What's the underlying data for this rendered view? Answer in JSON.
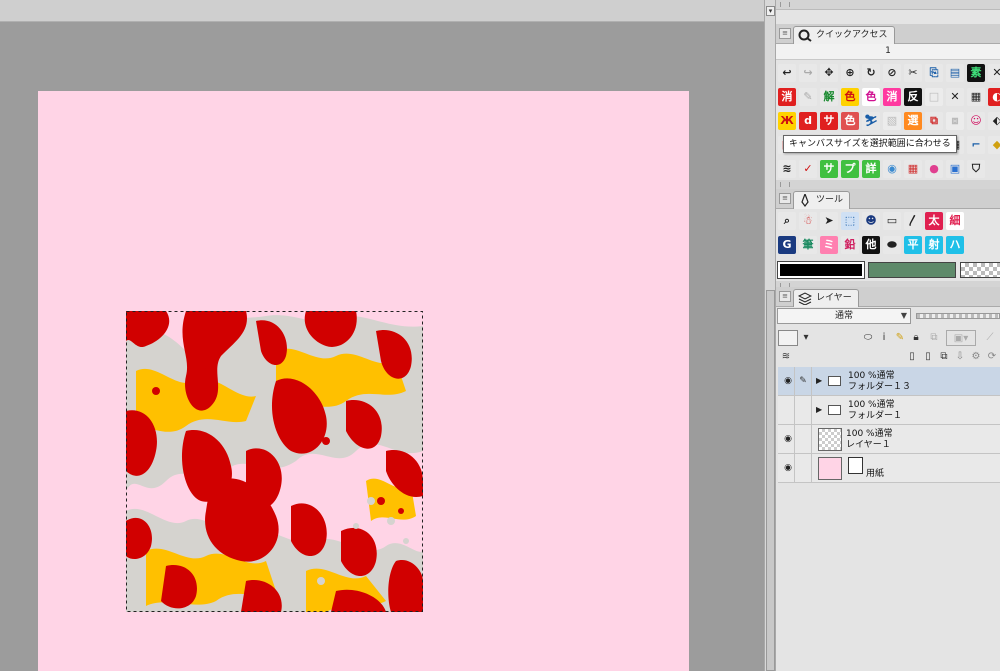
{
  "quick_access": {
    "tab_label": "クイックアクセス",
    "page_number": "1",
    "tooltip": "キャンバスサイズを選択範囲に合わせる",
    "icon_rows": [
      [
        {
          "glyph": "↩",
          "bg": "#e8e8e8",
          "fg": "#222",
          "name": "undo-icon"
        },
        {
          "glyph": "↪",
          "bg": "#e8e8e8",
          "fg": "#aaa",
          "name": "redo-icon"
        },
        {
          "glyph": "✥",
          "bg": "#e8e8e8",
          "fg": "#222",
          "name": "transform-icon"
        },
        {
          "glyph": "⊕",
          "bg": "#e8e8e8",
          "fg": "#222",
          "name": "crosshair-icon"
        },
        {
          "glyph": "↻",
          "bg": "#e8e8e8",
          "fg": "#222",
          "name": "rotate-icon"
        },
        {
          "glyph": "⊘",
          "bg": "#e8e8e8",
          "fg": "#222",
          "name": "clear-icon"
        },
        {
          "glyph": "✂",
          "bg": "#e8e8e8",
          "fg": "#222",
          "name": "cut-icon"
        },
        {
          "glyph": "⎘",
          "bg": "#e8e8e8",
          "fg": "#1a5ea8",
          "name": "copy-icon"
        },
        {
          "glyph": "▤",
          "bg": "#e8e8e8",
          "fg": "#1a5ea8",
          "name": "paste-icon"
        },
        {
          "glyph": "素",
          "bg": "#111111",
          "fg": "#3fe07a",
          "name": "material-icon"
        },
        {
          "glyph": "✕",
          "bg": "#e8e8e8",
          "fg": "#222",
          "name": "close-small-icon"
        }
      ],
      [
        {
          "glyph": "消",
          "bg": "#e02020",
          "fg": "#ffffff",
          "name": "erase-icon"
        },
        {
          "glyph": "✎",
          "bg": "#e8e8e8",
          "fg": "#aaa",
          "name": "pen-off-icon"
        },
        {
          "glyph": "解",
          "bg": "#e8e8e8",
          "fg": "#1a8a30",
          "name": "deselect-icon"
        },
        {
          "glyph": "色",
          "bg": "#ffd200",
          "fg": "#d01010",
          "name": "color-select-icon"
        },
        {
          "glyph": "色",
          "bg": "#ffffff",
          "fg": "#d01090",
          "name": "color-select-2-icon"
        },
        {
          "glyph": "消",
          "bg": "#ff3aa0",
          "fg": "#ffffff",
          "name": "erase-2-icon"
        },
        {
          "glyph": "反",
          "bg": "#111111",
          "fg": "#ffffff",
          "name": "invert-icon"
        },
        {
          "glyph": "□",
          "bg": "#ececec",
          "fg": "#bbb",
          "name": "dim-icon"
        },
        {
          "glyph": "✕",
          "bg": "#e8e8e8",
          "fg": "#222",
          "name": "cross-icon"
        },
        {
          "glyph": "▦",
          "bg": "#e8e8e8",
          "fg": "#222",
          "name": "grid-select-icon"
        },
        {
          "glyph": "◐",
          "bg": "#e02020",
          "fg": "#fff",
          "name": "red-mask-icon"
        }
      ],
      [
        {
          "glyph": "Ж",
          "bg": "#ffd200",
          "fg": "#d01010",
          "name": "scissors-select-icon"
        },
        {
          "glyph": "d",
          "bg": "#e02020",
          "fg": "#ffffff",
          "name": "brush-d-icon"
        },
        {
          "glyph": "サ",
          "bg": "#e02020",
          "fg": "#ffffff",
          "name": "sa-icon"
        },
        {
          "glyph": "色",
          "bg": "#e05050",
          "fg": "#ffffff",
          "name": "color-fill-icon"
        },
        {
          "glyph": "⛷",
          "bg": "#e8e8e8",
          "fg": "#1a5ea8",
          "name": "figure-icon"
        },
        {
          "glyph": "▧",
          "bg": "#ececec",
          "fg": "#bbb",
          "name": "dim-pattern-icon"
        },
        {
          "glyph": "選",
          "bg": "#ff8a20",
          "fg": "#ffffff",
          "name": "select-orange-icon"
        },
        {
          "glyph": "⧉",
          "bg": "#e8e8e8",
          "fg": "#d03030",
          "name": "canvas-fit-icon"
        },
        {
          "glyph": "⧈",
          "bg": "#ececec",
          "fg": "#bbb",
          "name": "dim-frame-icon"
        },
        {
          "glyph": "☺",
          "bg": "#e8e8e8",
          "fg": "#d01060",
          "name": "character-icon"
        },
        {
          "glyph": "⬖",
          "bg": "#e8e8e8",
          "fg": "#222",
          "name": "half-icon"
        }
      ],
      [
        {
          "glyph": "□",
          "bg": "#e8e8e8",
          "fg": "#d02020",
          "name": "frame-red-icon"
        },
        {
          "glyph": " ",
          "bg": "#e4e4e4",
          "fg": "#222",
          "name": "hidden-slot-1"
        },
        {
          "glyph": " ",
          "bg": "#e4e4e4",
          "fg": "#222",
          "name": "hidden-slot-2"
        },
        {
          "glyph": " ",
          "bg": "#e4e4e4",
          "fg": "#222",
          "name": "hidden-slot-3"
        },
        {
          "glyph": " ",
          "bg": "#e4e4e4",
          "fg": "#222",
          "name": "hidden-slot-4"
        },
        {
          "glyph": " ",
          "bg": "#e4e4e4",
          "fg": "#222",
          "name": "hidden-slot-5"
        },
        {
          "glyph": " ",
          "bg": "#e4e4e4",
          "fg": "#222",
          "name": "hidden-slot-6"
        },
        {
          "glyph": " ",
          "bg": "#e4e4e4",
          "fg": "#222",
          "name": "hidden-slot-7"
        },
        {
          "glyph": "▦",
          "bg": "#e8e8e8",
          "fg": "#222",
          "name": "grid-icon"
        },
        {
          "glyph": "⌐",
          "bg": "#e8e8e8",
          "fg": "#1a5ea8",
          "name": "ruler-icon"
        },
        {
          "glyph": "◆",
          "bg": "#e8e8e8",
          "fg": "#d0a010",
          "name": "diamond-icon"
        }
      ],
      [
        {
          "glyph": "≋",
          "bg": "#e8e8e8",
          "fg": "#222",
          "name": "layers-icon"
        },
        {
          "glyph": "✓",
          "bg": "#e8e8e8",
          "fg": "#d01010",
          "name": "check-icon"
        },
        {
          "glyph": "サ",
          "bg": "#40c040",
          "fg": "#ffffff",
          "name": "sa-green-icon"
        },
        {
          "glyph": "プ",
          "bg": "#40c040",
          "fg": "#ffffff",
          "name": "pu-green-icon"
        },
        {
          "glyph": "詳",
          "bg": "#40c040",
          "fg": "#ffffff",
          "name": "detail-green-icon"
        },
        {
          "glyph": "◉",
          "bg": "#e8e8e8",
          "fg": "#3a8ad0",
          "name": "navigator-icon"
        },
        {
          "glyph": "▦",
          "bg": "#e8e8e8",
          "fg": "#d03030",
          "name": "color-grid-icon"
        },
        {
          "glyph": "●",
          "bg": "#e8e8e8",
          "fg": "#e04090",
          "name": "color-wheel-icon"
        },
        {
          "glyph": "▣",
          "bg": "#e8e8e8",
          "fg": "#2a70d0",
          "name": "color-set-icon"
        },
        {
          "glyph": "⛉",
          "bg": "#e8e8e8",
          "fg": "#222",
          "name": "bucket-icon"
        }
      ]
    ]
  },
  "tool_panel": {
    "tab_label": "ツール",
    "icon_rows": [
      [
        {
          "glyph": "⌕",
          "bg": "#e8e8e8",
          "fg": "#222",
          "name": "zoom-tool-icon"
        },
        {
          "glyph": "☃",
          "bg": "#e8e8e8",
          "fg": "#d02020",
          "name": "figure-tool-icon"
        },
        {
          "glyph": "➤",
          "bg": "#e8e8e8",
          "fg": "#222",
          "name": "move-tool-icon"
        },
        {
          "glyph": "⬚",
          "bg": "#cfe0f4",
          "fg": "#1a5ea8",
          "name": "selection-tool-icon"
        },
        {
          "glyph": "☻",
          "bg": "#e8e8e8",
          "fg": "#1a3a80",
          "name": "face-tool-icon"
        },
        {
          "glyph": "▭",
          "bg": "#e8e8e8",
          "fg": "#222",
          "name": "rect-tool-icon"
        },
        {
          "glyph": "〳",
          "bg": "#e8e8e8",
          "fg": "#222",
          "name": "line-tool-icon"
        },
        {
          "glyph": "太",
          "bg": "#e02050",
          "fg": "#ffffff",
          "name": "bold-tool-icon"
        },
        {
          "glyph": "細",
          "bg": "#ffffff",
          "fg": "#e02050",
          "name": "thin-tool-icon"
        }
      ],
      [
        {
          "glyph": "G",
          "bg": "#1a3a80",
          "fg": "#ffffff",
          "name": "g-tool-icon"
        },
        {
          "glyph": "筆",
          "bg": "#e8e8e8",
          "fg": "#1a8a60",
          "name": "brush-tool-icon"
        },
        {
          "glyph": "ミ",
          "bg": "#ff80b0",
          "fg": "#ffffff",
          "name": "mi-tool-icon"
        },
        {
          "glyph": "鉛",
          "bg": "#e8e8e8",
          "fg": "#d02060",
          "name": "pencil-tool-icon"
        },
        {
          "glyph": "他",
          "bg": "#111111",
          "fg": "#ffffff",
          "name": "other-tool-icon"
        },
        {
          "glyph": "⬬",
          "bg": "#e8e8e8",
          "fg": "#222",
          "name": "blob-tool-icon"
        },
        {
          "glyph": "平",
          "bg": "#20c0e8",
          "fg": "#ffffff",
          "name": "flat-tool-icon"
        },
        {
          "glyph": "射",
          "bg": "#20c0e8",
          "fg": "#ffffff",
          "name": "ray-tool-icon"
        },
        {
          "glyph": "ハ",
          "bg": "#20c0e8",
          "fg": "#ffffff",
          "name": "ha-tool-icon"
        }
      ]
    ],
    "swatches": [
      {
        "name": "main-color-swatch",
        "color": "#000000"
      },
      {
        "name": "sub-color-swatch",
        "color": "#5e8a6a"
      },
      {
        "name": "transparent-swatch",
        "color": "checker"
      }
    ]
  },
  "layer_panel": {
    "tab_label": "レイヤー",
    "blend_mode": "通常",
    "layers": [
      {
        "name_label": "フォルダー１３",
        "opacity_mode": "100 %通常",
        "type": "folder",
        "visible": true,
        "selected": true,
        "pen": true
      },
      {
        "name_label": "フォルダー１",
        "opacity_mode": "100 %通常",
        "type": "folder",
        "visible": false,
        "selected": false,
        "pen": false
      },
      {
        "name_label": "レイヤー１",
        "opacity_mode": "100 %通常",
        "type": "raster",
        "visible": true,
        "selected": false,
        "pen": false
      },
      {
        "name_label": "用紙",
        "opacity_mode": "",
        "type": "paper",
        "visible": true,
        "selected": false,
        "pen": false
      }
    ]
  },
  "canvas": {
    "paper_color": "#ffd4e6",
    "art_colors": [
      "#d10000",
      "#ffc000",
      "#d5d3cf"
    ]
  }
}
